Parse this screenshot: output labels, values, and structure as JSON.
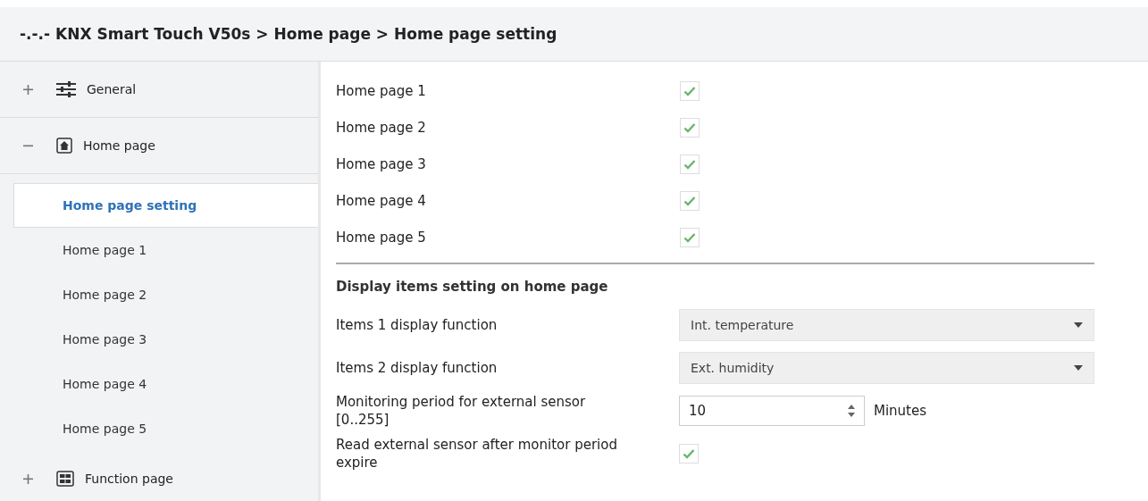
{
  "title": "-.-.- KNX Smart Touch V50s > Home page > Home page setting",
  "sidebar": {
    "items": [
      {
        "label": "General",
        "expanded": false
      },
      {
        "label": "Home page",
        "expanded": true,
        "children": [
          {
            "label": "Home page setting",
            "selected": true
          },
          {
            "label": "Home page 1",
            "selected": false
          },
          {
            "label": "Home page 2",
            "selected": false
          },
          {
            "label": "Home page 3",
            "selected": false
          },
          {
            "label": "Home page 4",
            "selected": false
          },
          {
            "label": "Home page 5",
            "selected": false
          }
        ]
      },
      {
        "label": "Function page",
        "expanded": false
      }
    ]
  },
  "pages": [
    {
      "label": "Home page 1",
      "checked": true
    },
    {
      "label": "Home page 2",
      "checked": true
    },
    {
      "label": "Home page 3",
      "checked": true
    },
    {
      "label": "Home page 4",
      "checked": true
    },
    {
      "label": "Home page 5",
      "checked": true
    }
  ],
  "section_heading": "Display items setting on home page",
  "fields": [
    {
      "kind": "select",
      "label": "Items 1 display function",
      "value": "Int. temperature"
    },
    {
      "kind": "select",
      "label": "Items 2 display function",
      "value": "Ext. humidity"
    },
    {
      "kind": "number",
      "label": "Monitoring period for external sensor [0..255]",
      "value": "10",
      "unit": "Minutes"
    },
    {
      "kind": "checkbox",
      "label": "Read external sensor after monitor period expire",
      "checked": true
    }
  ]
}
